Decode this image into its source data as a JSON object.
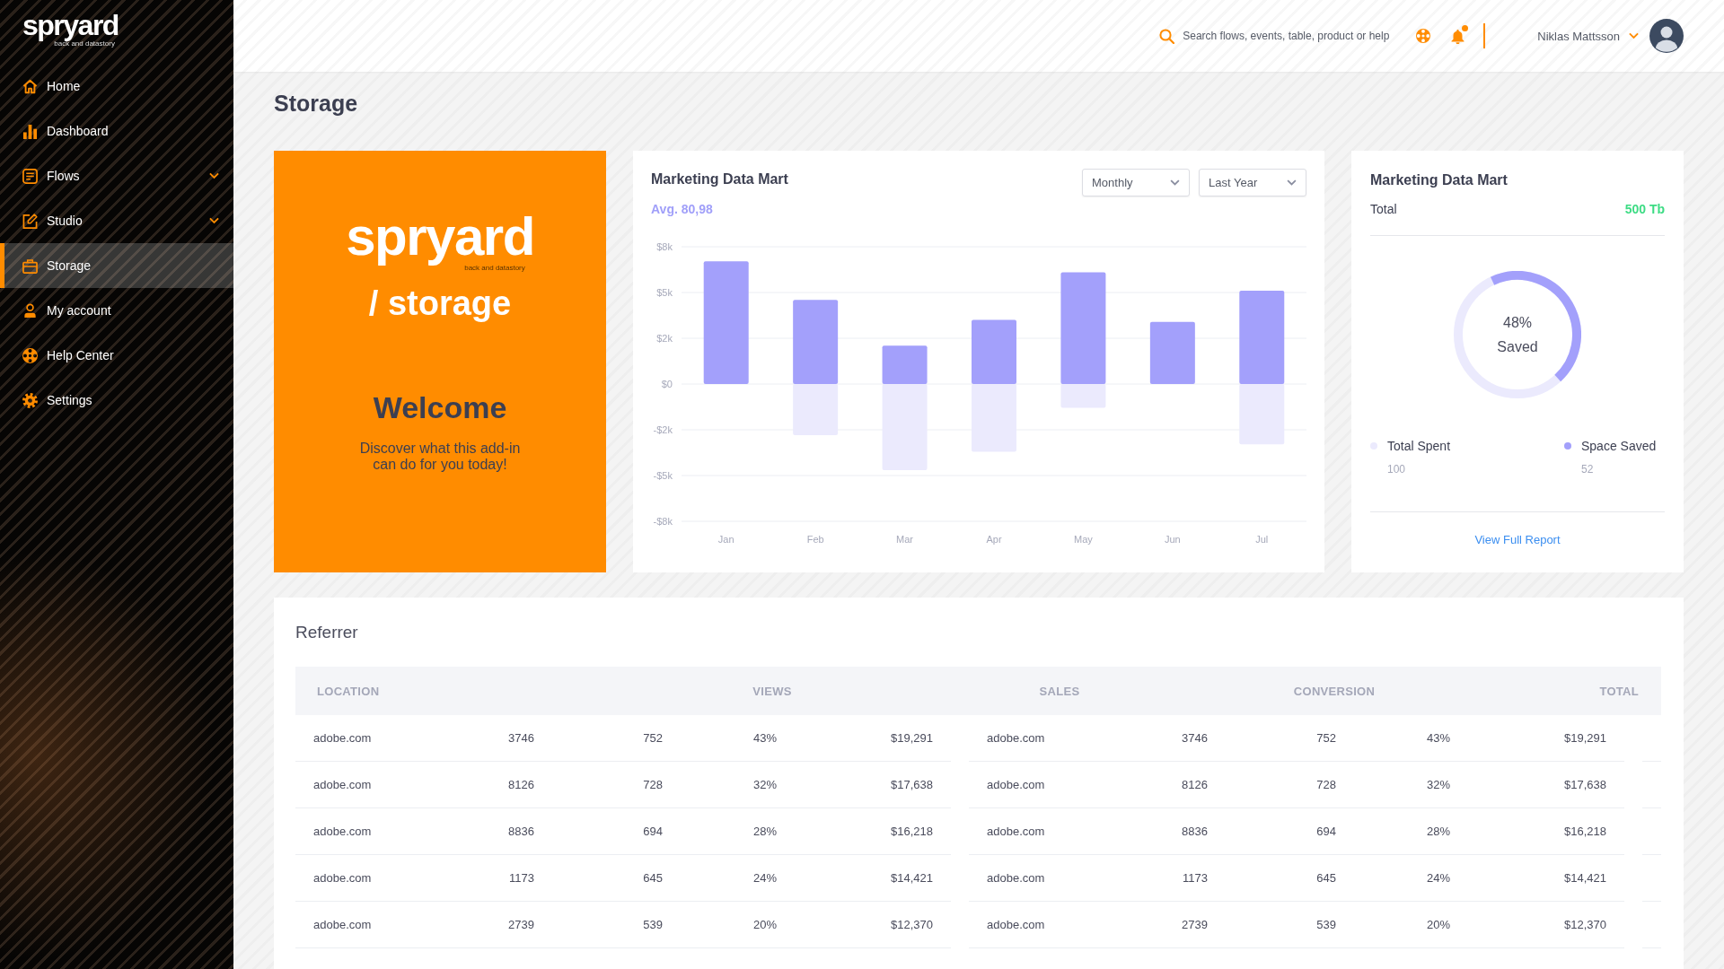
{
  "sidebar": {
    "logo": "spryard",
    "tagline": "back and datastory",
    "items": [
      {
        "label": "Home",
        "kind": "link",
        "selected": false
      },
      {
        "label": "Dashboard",
        "kind": "link",
        "selected": false
      },
      {
        "label": "Flows",
        "kind": "submenu",
        "selected": false
      },
      {
        "label": "Studio",
        "kind": "submenu",
        "selected": false
      },
      {
        "label": "Storage",
        "kind": "link",
        "selected": true
      },
      {
        "label": "My account",
        "kind": "link",
        "selected": false
      },
      {
        "label": "Help Center",
        "kind": "link",
        "selected": false
      },
      {
        "label": "Settings",
        "kind": "link",
        "selected": false
      }
    ]
  },
  "topbar": {
    "search": {
      "placeholder": "Search flows, events, table, product or help"
    },
    "notifications": {
      "unread": true
    },
    "user": {
      "name": "Niklas Mattsson"
    }
  },
  "page": {
    "title": "Storage"
  },
  "welcome_card": {
    "logo": "spryard",
    "tagline": "back and datastory",
    "product": "/ storage",
    "heading": "Welcome",
    "text": "Discover what this add-in can do for you today!"
  },
  "chart_card": {
    "title": "Marketing Data Mart",
    "average": "Avg. 80,98",
    "filters": [
      {
        "label": "Monthly"
      },
      {
        "label": "Last Year"
      }
    ],
    "chart_data": {
      "type": "bar",
      "categories": [
        "Jan",
        "Feb",
        "Mar",
        "Apr",
        "May",
        "Jun",
        "Jul"
      ],
      "series": [
        {
          "color": "#a3a0fb",
          "values": [
            6700,
            4600,
            2100,
            3500,
            6100,
            3400,
            5100
          ]
        },
        {
          "color": "#ebeafd",
          "values": [
            null,
            -2800,
            -4700,
            -3700,
            -1300,
            null,
            -3300
          ]
        }
      ],
      "stacked": true,
      "grid": true,
      "ylim": [
        -7500,
        7500
      ],
      "yticks": [
        {
          "value": 7500,
          "label": "$8k"
        },
        {
          "value": 5000,
          "label": "$5k"
        },
        {
          "value": 2500,
          "label": "$2k"
        },
        {
          "value": 0,
          "label": "$0"
        },
        {
          "value": -2500,
          "label": "-$2k"
        },
        {
          "value": -5000,
          "label": "-$5k"
        },
        {
          "value": -7500,
          "label": "-$8k"
        }
      ]
    }
  },
  "storage_card": {
    "title": "Marketing Data Mart",
    "total_label": "Total",
    "total_value": "500 Tb",
    "donut": {
      "level": 0.45,
      "value": "48%",
      "caption": "Saved"
    },
    "legend": [
      {
        "label": "Total Spent",
        "value": "100",
        "color": "#ebeafd"
      },
      {
        "label": "Space Saved",
        "value": "52",
        "color": "#a3a0fb"
      }
    ],
    "link": "View Full Report"
  },
  "referrer": {
    "title": "Referrer",
    "columns": [
      "LOCATION",
      "",
      "",
      "VIEWS",
      "",
      "SALES",
      "",
      "CONVERSION",
      "",
      "TOTAL"
    ],
    "rows": [
      {
        "cells": [
          "adobe.com",
          "3746",
          "752",
          "43%",
          "$19,291",
          "adobe.com",
          "3746",
          "752",
          "43%",
          "$19,291"
        ]
      },
      {
        "cells": [
          "adobe.com",
          "8126",
          "728",
          "32%",
          "$17,638",
          "adobe.com",
          "8126",
          "728",
          "32%",
          "$17,638"
        ]
      },
      {
        "cells": [
          "adobe.com",
          "8836",
          "694",
          "28%",
          "$16,218",
          "adobe.com",
          "8836",
          "694",
          "28%",
          "$16,218"
        ]
      },
      {
        "cells": [
          "adobe.com",
          "1173",
          "645",
          "24%",
          "$14,421",
          "adobe.com",
          "1173",
          "645",
          "24%",
          "$14,421"
        ]
      },
      {
        "cells": [
          "adobe.com",
          "2739",
          "539",
          "20%",
          "$12,370",
          "adobe.com",
          "2739",
          "539",
          "20%",
          "$12,370"
        ]
      }
    ]
  }
}
